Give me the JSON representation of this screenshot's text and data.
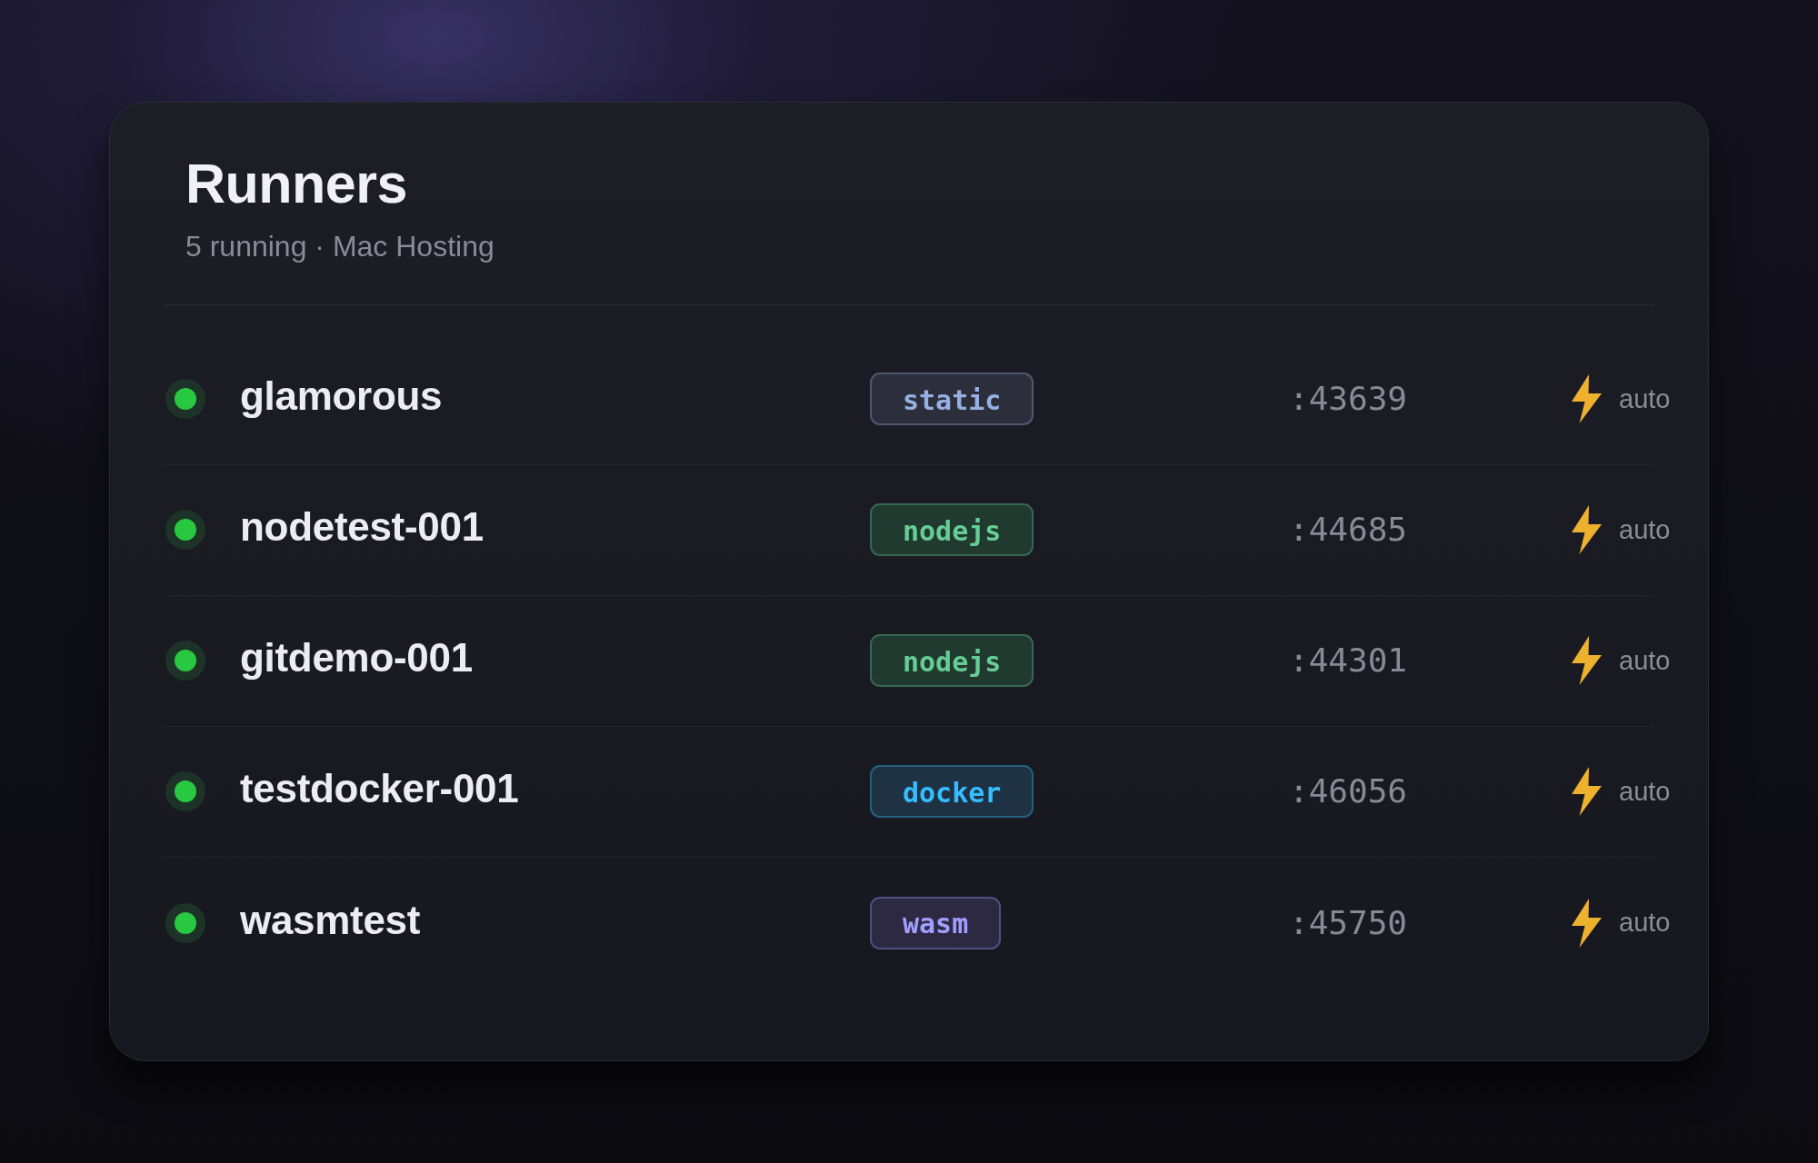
{
  "header": {
    "title": "Runners",
    "subtitle": "5 running · Mac Hosting"
  },
  "runners": [
    {
      "name": "glamorous",
      "running": true,
      "runtime": {
        "label": "static",
        "color": "#2c2f3b"
      },
      "port": ":43639",
      "mode": "auto"
    },
    {
      "name": "nodetest-001",
      "running": true,
      "runtime": {
        "label": "nodejs",
        "color": "#213a30"
      },
      "port": ":44685",
      "mode": "auto"
    },
    {
      "name": "gitdemo-001",
      "running": true,
      "runtime": {
        "label": "nodejs",
        "color": "#213a30"
      },
      "port": ":44301",
      "mode": "auto"
    },
    {
      "name": "testdocker-001",
      "running": true,
      "runtime": {
        "label": "docker",
        "color": "#1e3244"
      },
      "port": ":46056",
      "mode": "auto"
    },
    {
      "name": "wasmtest",
      "running": true,
      "runtime": {
        "label": "wasm",
        "color": "#2e2942"
      },
      "port": ":45750",
      "mode": "auto"
    }
  ]
}
